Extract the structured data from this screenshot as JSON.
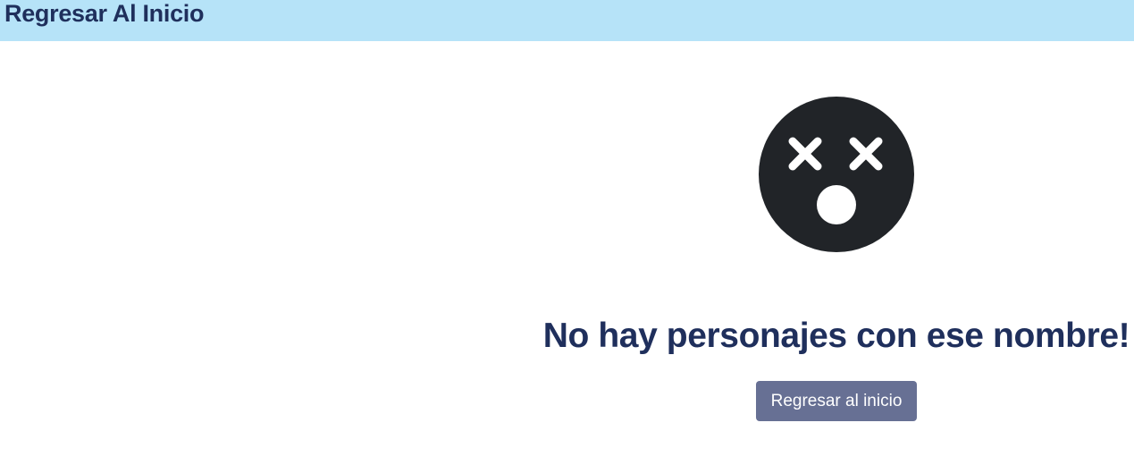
{
  "header": {
    "home_link_label": "Regresar Al Inicio"
  },
  "main": {
    "icon": "dizzy-face-icon",
    "message": "No hay personajes con ese nombre!",
    "back_button_label": "Regresar al inicio"
  },
  "colors": {
    "header_background": "#b6e3f8",
    "text_navy": "#1f2f5c",
    "icon_dark": "#212428",
    "button_background": "#677094",
    "button_text": "#ffffff"
  }
}
